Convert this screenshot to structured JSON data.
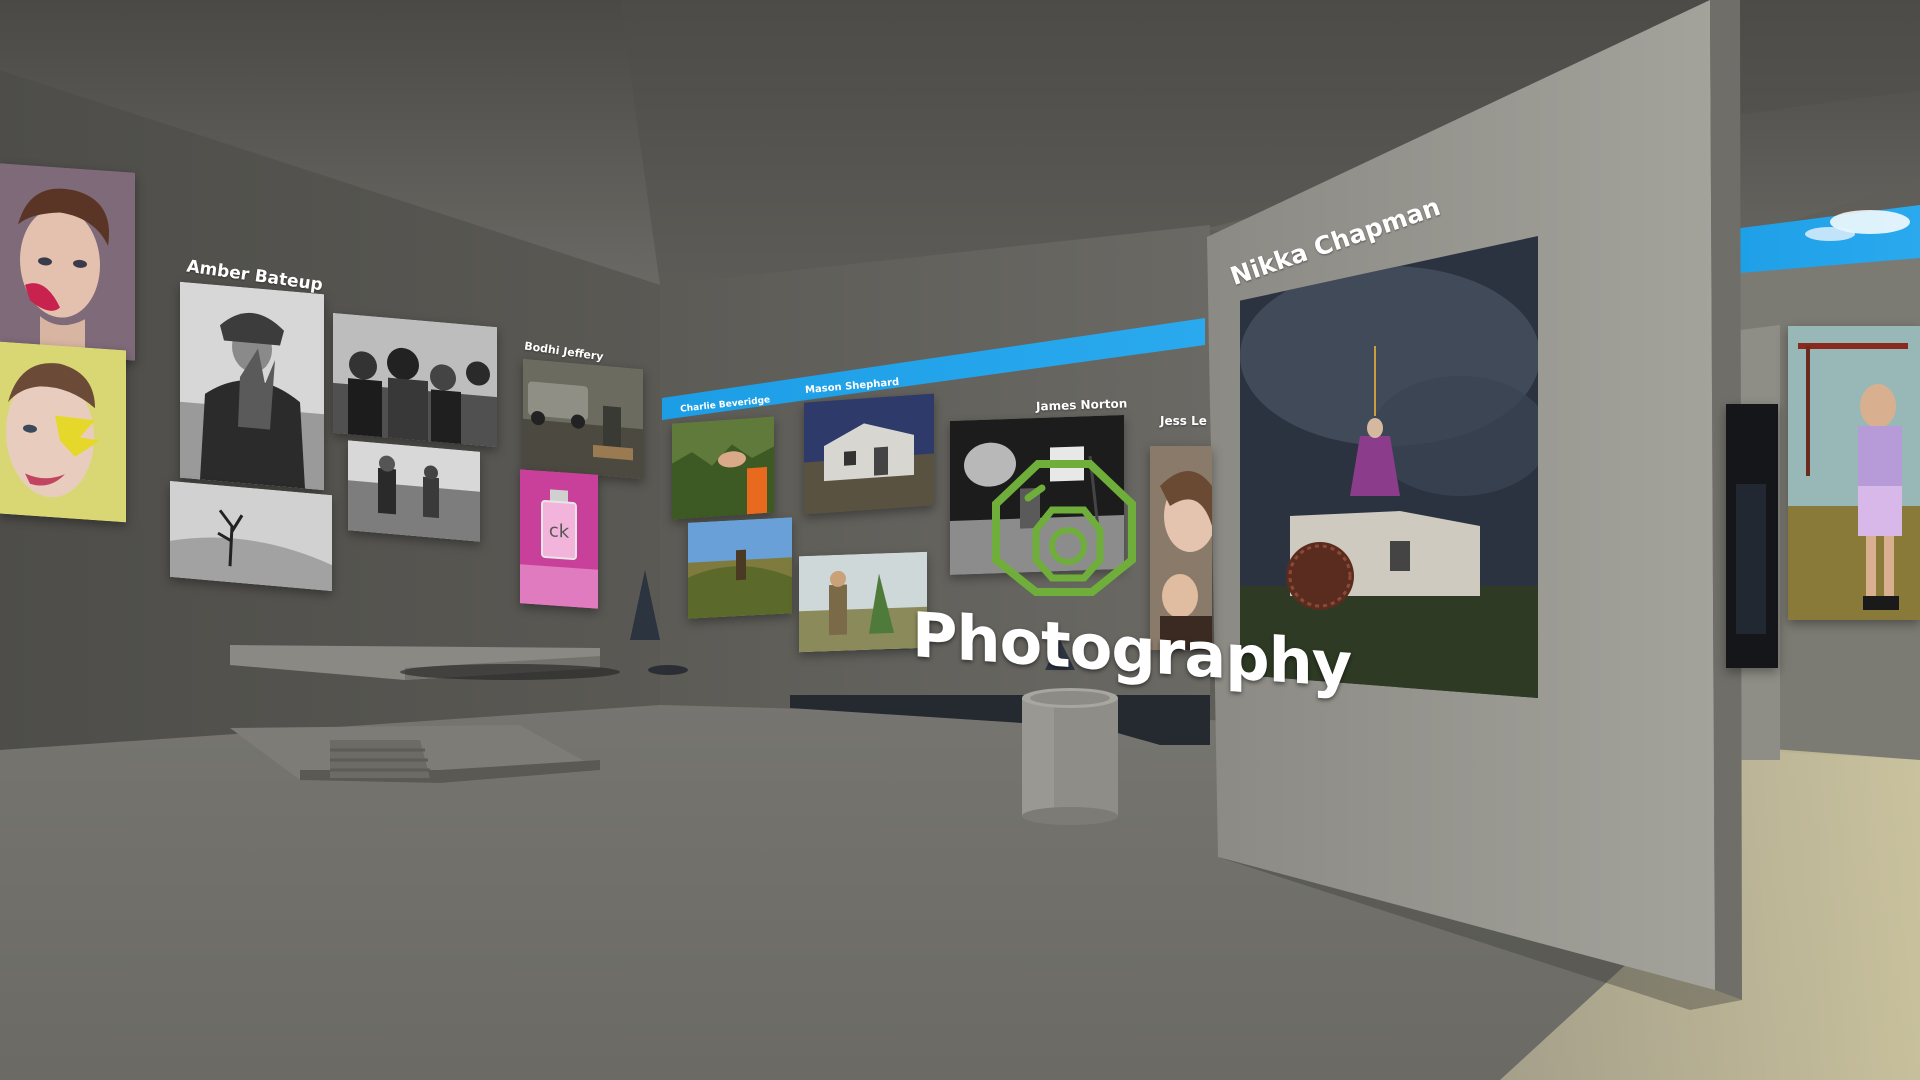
{
  "gallery": {
    "hotspot": {
      "label": "Photography",
      "icon": "camera-icon",
      "accent_color": "#6fae3a"
    },
    "banner_color": "#1ea3e8",
    "artists": {
      "amber": "Amber Bateup",
      "bodhi": "Bodhi Jeffery",
      "charlie": "Charlie Beveridge",
      "mason": "Mason Shephard",
      "james": "James Norton",
      "jess": "Jess Le",
      "nikka": "Nikka Chapman"
    },
    "photo_labels": {
      "ck_bottle": "ck"
    }
  }
}
